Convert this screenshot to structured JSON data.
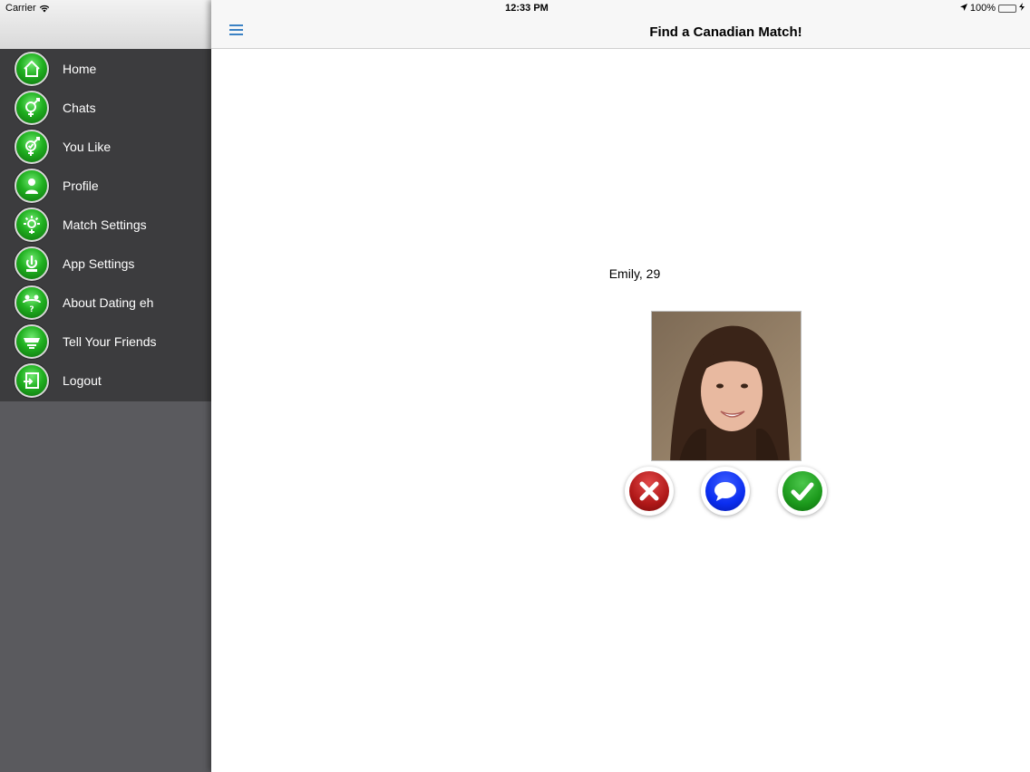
{
  "status_bar": {
    "carrier": "Carrier",
    "time": "12:33 PM",
    "battery": "100%"
  },
  "navbar": {
    "title": "Find a Canadian Match!"
  },
  "menu": {
    "items": [
      {
        "label": "Home",
        "icon": "home-icon"
      },
      {
        "label": "Chats",
        "icon": "gender-chat-icon"
      },
      {
        "label": "You Like",
        "icon": "gender-like-icon"
      },
      {
        "label": "Profile",
        "icon": "profile-icon"
      },
      {
        "label": "Match Settings",
        "icon": "match-settings-icon"
      },
      {
        "label": "App Settings",
        "icon": "app-settings-icon"
      },
      {
        "label": "About Dating eh",
        "icon": "about-icon"
      },
      {
        "label": "Tell Your Friends",
        "icon": "tell-friends-icon"
      },
      {
        "label": "Logout",
        "icon": "logout-icon"
      }
    ]
  },
  "match": {
    "name_age": "Emily, 29"
  },
  "actions": {
    "reject": "reject-x-icon",
    "chat": "chat-bubble-icon",
    "accept": "accept-check-icon"
  },
  "colors": {
    "menu_bg": "#3c3c3e",
    "drawer_bg": "#5a5a5e",
    "icon_green": "#20b020",
    "link_blue": "#3b82c4"
  }
}
